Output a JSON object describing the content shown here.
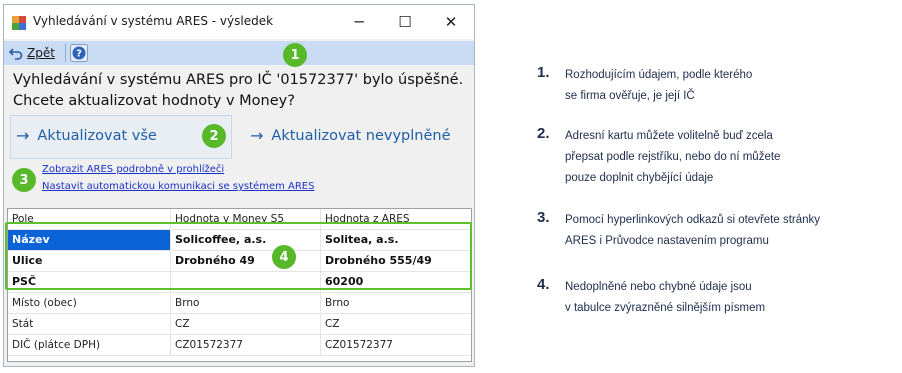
{
  "window": {
    "title": "Vyhledávání v systému ARES - výsledek",
    "minimize": "─",
    "maximize": "☐",
    "close": "✕"
  },
  "toolbar": {
    "back_label": "Zpět",
    "back_icon": "undo-arrow-icon",
    "help_icon": "help-icon"
  },
  "message": {
    "line1": "Vyhledávání v systému ARES pro IČ '01572377' bylo úspěšné.",
    "line2": "Chcete aktualizovat hodnoty v Money?"
  },
  "actions": {
    "update_all": "Aktualizovat vše",
    "update_empty": "Aktualizovat nevyplněné",
    "arrow": "→"
  },
  "links": {
    "show_ares": "Zobrazit ARES podrobně v prohlížeči",
    "auto_setup": "Nastavit automatickou komunikaci se systémem ARES"
  },
  "table": {
    "headers": [
      "Pole",
      "Hodnota v Money S5",
      "Hodnota z ARES"
    ],
    "rows": [
      {
        "field": "Název",
        "money": "Solicoffee, a.s.",
        "ares": "Solitea, a.s."
      },
      {
        "field": "Ulice",
        "money": "Drobného 49",
        "ares": "Drobného 555/49"
      },
      {
        "field": "PSČ",
        "money": "",
        "ares": "60200"
      },
      {
        "field": "Místo (obec)",
        "money": "Brno",
        "ares": "Brno"
      },
      {
        "field": "Stát",
        "money": "CZ",
        "ares": "CZ"
      },
      {
        "field": "DIČ (plátce DPH)",
        "money": "CZ01572377",
        "ares": "CZ01572377"
      }
    ]
  },
  "badges": [
    "1",
    "2",
    "3",
    "4"
  ],
  "notes": [
    {
      "num": "1.",
      "lines": [
        "Rozhodujícím údajem, podle kterého",
        "se firma ověřuje, je její IČ"
      ]
    },
    {
      "num": "2.",
      "lines": [
        "Adresní kartu můžete volitelně buď zcela",
        "přepsat podle rejstříku, nebo do ní můžete",
        "pouze doplnit chybějící údaje"
      ]
    },
    {
      "num": "3.",
      "lines": [
        "Pomocí hyperlinkových odkazů si otevřete stránky",
        "ARES i Průvodce nastavením programu"
      ]
    },
    {
      "num": "4.",
      "lines": [
        "Nedoplněné nebo chybné údaje jsou",
        "v tabulce zvýrazněné silnějším písmem"
      ]
    }
  ],
  "colors": {
    "accent_green": "#57b829",
    "link_blue": "#1a31c8",
    "action_blue": "#1f5fa8",
    "selection_blue": "#0a64d8",
    "note_text": "#1f2d4d"
  }
}
